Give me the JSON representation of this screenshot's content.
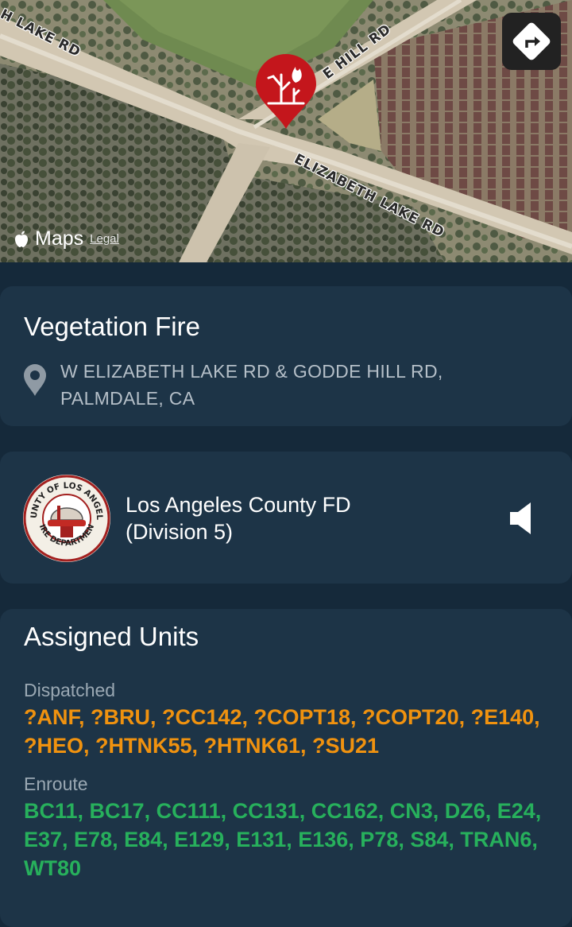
{
  "map": {
    "road_labels": {
      "lake_rd": "H LAKE RD",
      "hill_rd": "E HILL RD",
      "elizabeth_lake_rd": "ELIZABETH LAKE RD"
    },
    "attribution": {
      "brand": "Maps",
      "legal": "Legal"
    },
    "pin_color": "#c4161c",
    "pin_icon": "vegetation-fire-icon",
    "directions_icon": "directions-icon"
  },
  "incident": {
    "title": "Vegetation Fire",
    "address_line1": "W ELIZABETH LAKE RD & GODDE HILL RD,",
    "address_line2": "PALMDALE, CA",
    "location_icon": "location-pin-icon"
  },
  "agency": {
    "name_line1": "Los Angeles County FD",
    "name_line2": "(Division 5)",
    "logo_text_top": "COUNTY OF LOS ANGELES",
    "logo_text_bottom": "FIRE DEPARTMENT",
    "audio_icon": "speaker-icon"
  },
  "units": {
    "title": "Assigned Units",
    "dispatched_label": "Dispatched",
    "dispatched": "?ANF, ?BRU, ?CC142, ?COPT18, ?COPT20, ?E140, ?HEO, ?HTNK55, ?HTNK61, ?SU21",
    "enroute_label": "Enroute",
    "enroute": "BC11, BC17, CC111, CC131, CC162, CN3, DZ6, E24, E37, E78, E84, E129, E131, E136, P78, S84, TRAN6, WT80"
  },
  "colors": {
    "background": "#15293a",
    "card": "#1d3447",
    "dispatched": "#f0920f",
    "enroute": "#27b05c"
  }
}
